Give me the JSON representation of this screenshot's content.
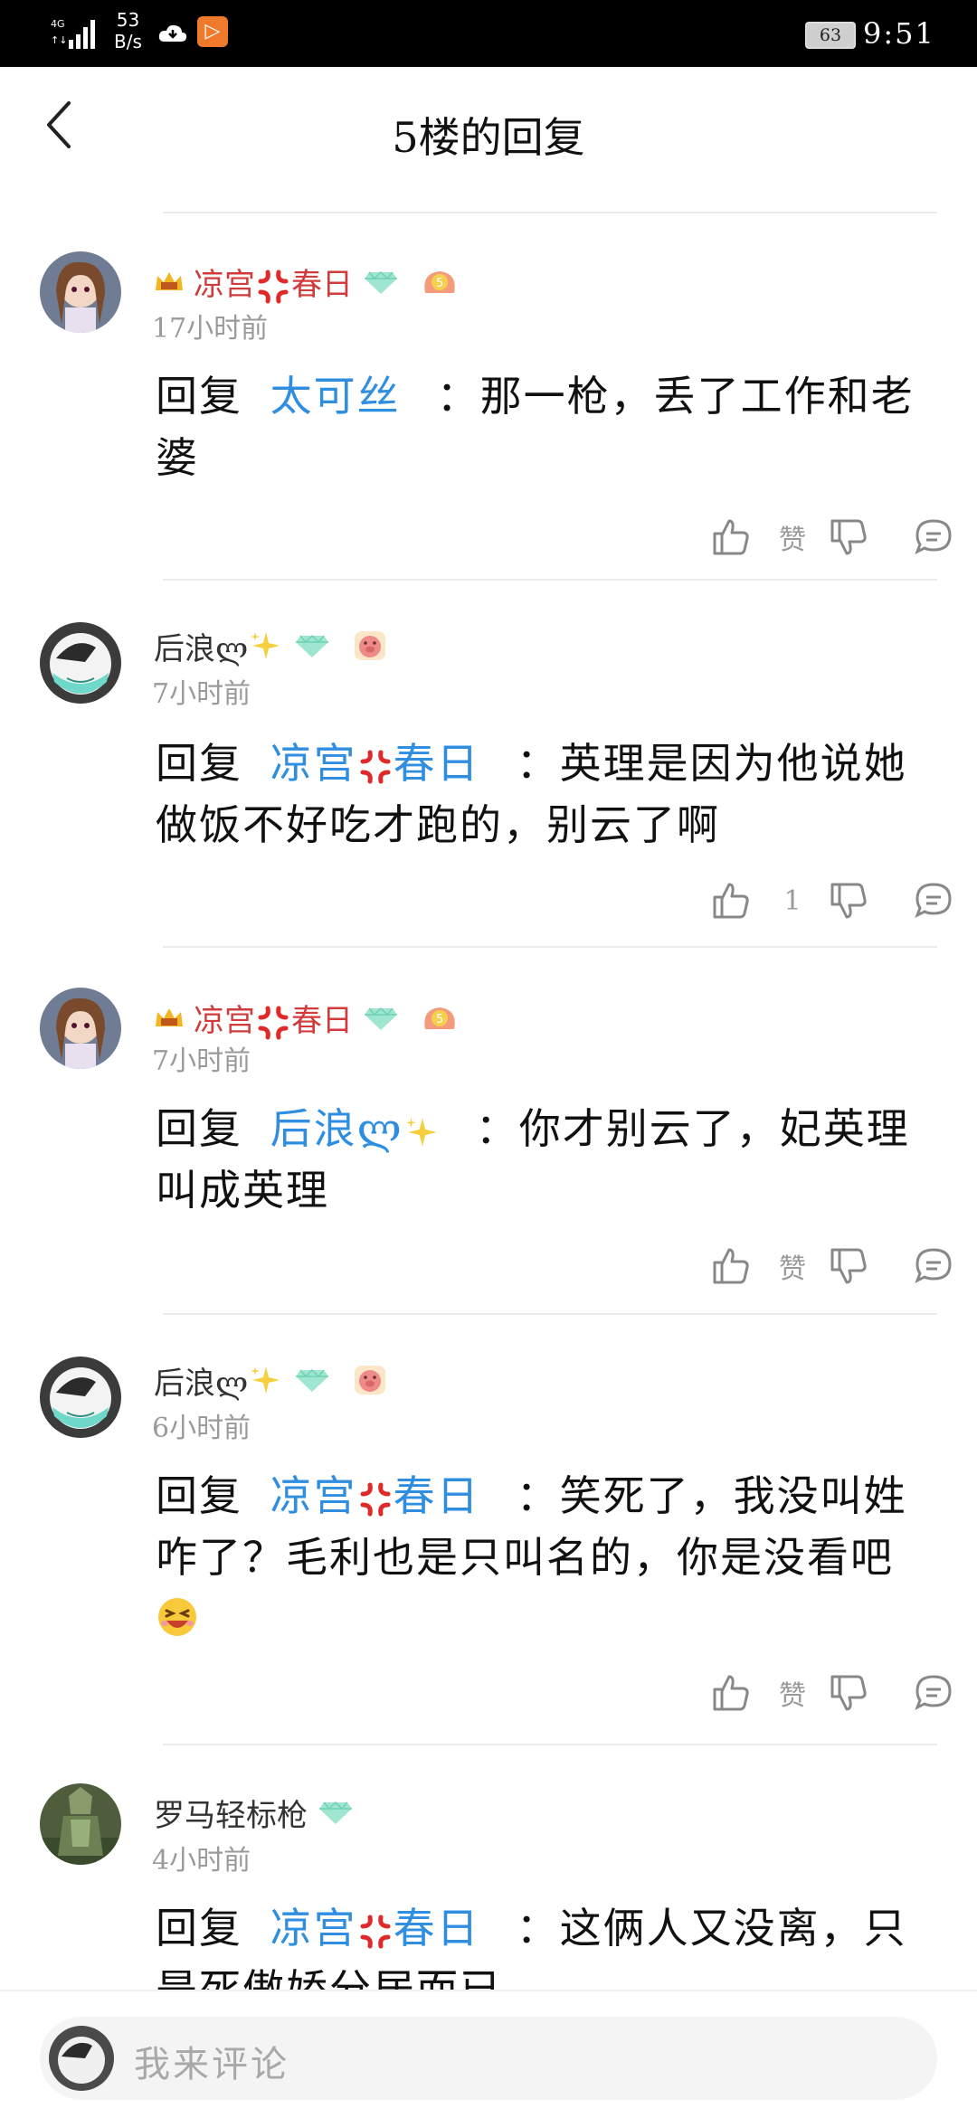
{
  "status_bar": {
    "net_speed_value": "53",
    "net_speed_unit": "B/s",
    "app_icon_glyph": "▷",
    "battery": "63",
    "time": "9:51"
  },
  "header": {
    "title": "5楼的回复"
  },
  "comments": [
    {
      "username": "凉宫",
      "username_tail": "春日",
      "username_color": "#d23b3b",
      "time": "17小时前",
      "reply_prefix": "回复",
      "mention": "太可丝",
      "text": "：那一枪，丢了工作和老婆",
      "likes": "赞",
      "icons": [
        "crown-badge-icon",
        "anger-icon",
        "diamond-badge-icon",
        "level-5-badge-icon"
      ]
    },
    {
      "username": "后浪ლ",
      "username_color": "#333333",
      "time": "7小时前",
      "reply_prefix": "回复",
      "mention": "凉宫",
      "mention_tail": "春日",
      "text": "：英理是因为他说她做饭不好吃才跑的，别云了啊",
      "likes": "1",
      "icons": [
        "sparkle-icon",
        "diamond-badge-icon",
        "pig-badge-icon"
      ]
    },
    {
      "username": "凉宫",
      "username_tail": "春日",
      "username_color": "#d23b3b",
      "time": "7小时前",
      "reply_prefix": "回复",
      "mention": "后浪ლ",
      "text": "：你才别云了，妃英理叫成英理",
      "likes": "赞",
      "icons": [
        "crown-badge-icon",
        "anger-icon",
        "diamond-badge-icon",
        "level-5-badge-icon"
      ]
    },
    {
      "username": "后浪ლ",
      "username_color": "#333333",
      "time": "6小时前",
      "reply_prefix": "回复",
      "mention": "凉宫",
      "mention_tail": "春日",
      "text": "：笑死了，我没叫姓咋了？毛利也是只叫名的，你是没看吧",
      "likes": "赞",
      "icons": [
        "sparkle-icon",
        "diamond-badge-icon",
        "pig-badge-icon",
        "laughing-emoji-icon"
      ]
    },
    {
      "username": "罗马轻标枪",
      "username_color": "#333333",
      "time": "4小时前",
      "reply_prefix": "回复",
      "mention": "凉宫",
      "mention_tail": "春日",
      "text": "：这俩人又没离，只是死傲娇分居而已",
      "icons": [
        "diamond-badge-icon"
      ]
    }
  ],
  "comment_input": {
    "placeholder": "我来评论"
  },
  "colors": {
    "mention": "#2f8ee0",
    "red_name": "#d23b3b",
    "muted": "#9a9a9a"
  }
}
